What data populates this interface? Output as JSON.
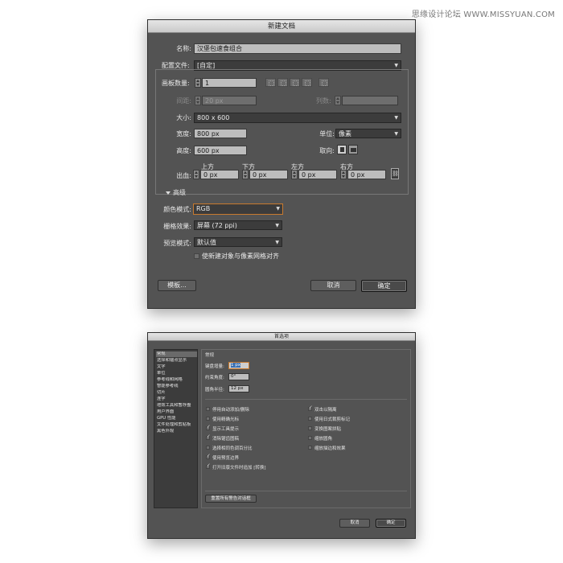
{
  "watermark": "思缘设计论坛  WWW.MISSYUAN.COM",
  "new_doc": {
    "title": "新建文档",
    "name_label": "名称:",
    "name_value": "汉堡包速食组合",
    "profile_label": "配置文件:",
    "profile_value": "[自定]",
    "artboards_label": "画板数量:",
    "artboards_value": "1",
    "spacing_label": "间距:",
    "spacing_value": "20 px",
    "columns_label": "列数:",
    "size_label": "大小:",
    "size_value": "800 x 600",
    "width_label": "宽度:",
    "width_value": "800 px",
    "units_label": "单位:",
    "units_value": "像素",
    "height_label": "高度:",
    "height_value": "600 px",
    "orientation_label": "取向:",
    "bleed_label": "出血:",
    "bleed_top_label": "上方",
    "bleed_bottom_label": "下方",
    "bleed_left_label": "左方",
    "bleed_right_label": "右方",
    "bleed_top": "0 px",
    "bleed_bottom": "0 px",
    "bleed_left": "0 px",
    "bleed_right": "0 px",
    "advanced_label": "高级",
    "color_mode_label": "颜色模式:",
    "color_mode_value": "RGB",
    "raster_label": "栅格效果:",
    "raster_value": "屏幕 (72 ppi)",
    "preview_label": "预览模式:",
    "preview_value": "默认值",
    "align_pixel_label": "使新建对象与像素网格对齐",
    "templates_button": "模板...",
    "cancel_button": "取消",
    "ok_button": "确定"
  },
  "prefs": {
    "title": "首选项",
    "sidebar": [
      "常规",
      "选择和锚点显示",
      "文字",
      "单位",
      "参考线和网格",
      "智能参考线",
      "切片",
      "连字",
      "增效工具和暂存盘",
      "用户界面",
      "GPU 性能",
      "文件处理和剪贴板",
      "黑色外观"
    ],
    "section_title": "常规",
    "keyboard_increment_label": "键盘增量:",
    "keyboard_increment_value": "1 px",
    "constrain_angle_label": "约束角度:",
    "constrain_angle_value": "0°",
    "corner_radius_label": "圆角半径:",
    "corner_radius_value": "12 px",
    "options_left": [
      {
        "label": "停用自动添加/删除",
        "checked": false
      },
      {
        "label": "使用精确光标",
        "checked": false
      },
      {
        "label": "显示工具提示",
        "checked": true
      },
      {
        "label": "消除锯齿图稿",
        "checked": true
      },
      {
        "label": "选择相同色调百分比",
        "checked": false
      },
      {
        "label": "使用预览边界",
        "checked": true
      },
      {
        "label": "打开旧版文件时追加 [转换]",
        "checked": true
      }
    ],
    "options_right": [
      {
        "label": "双击以隔离",
        "checked": true
      },
      {
        "label": "使用日式裁剪标记",
        "checked": false
      },
      {
        "label": "变换图案拼贴",
        "checked": false
      },
      {
        "label": "缩放圆角",
        "checked": false
      },
      {
        "label": "缩放描边和效果",
        "checked": false
      }
    ],
    "reset_warnings_button": "重置所有警告对话框",
    "cancel_button": "取消",
    "ok_button": "确定"
  }
}
